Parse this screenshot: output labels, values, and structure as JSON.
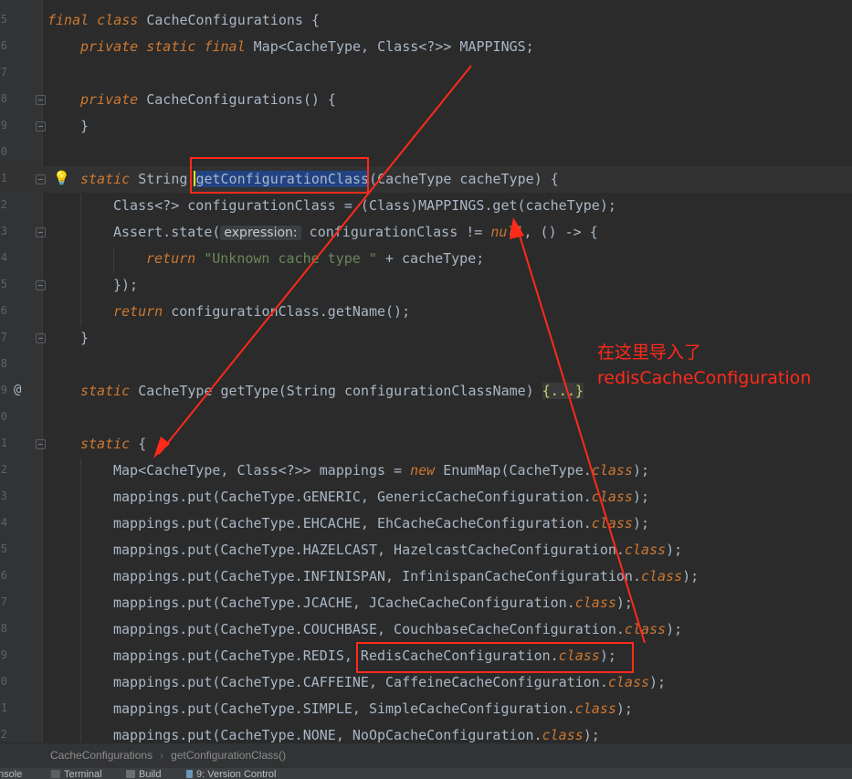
{
  "line_numbers": [
    "5",
    "6",
    "7",
    "8",
    "9",
    "0",
    "1",
    "2",
    "3",
    "4",
    "5",
    "6",
    "7",
    "8",
    "9",
    "0",
    "1",
    "2",
    "3",
    "4",
    "5",
    "6",
    "7",
    "8",
    "9",
    "0",
    "1",
    "2"
  ],
  "code": {
    "class_decl_kw": "final class",
    "class_decl_rest": " CacheConfigurations {",
    "field_kw": "private static final",
    "field_rest": " Map<CacheType, Class<?>> MAPPINGS;",
    "ctor_kw": "private",
    "ctor_rest": " CacheConfigurations() {",
    "ctor_close": "}",
    "method_kw": "static",
    "method_type": " String ",
    "method_name": "getConfigurationClass",
    "method_params": "(CacheType cacheType) {",
    "line_config": "Class<?> configurationClass = (Class)MAPPINGS.get(cacheType);",
    "assert_start": "Assert.state(",
    "assert_hint": "expression:",
    "assert_mid": " configurationClass != ",
    "assert_null": "null",
    "assert_end": ", () -> {",
    "return_kw": "return",
    "return_str": "\"Unknown cache type \"",
    "return_rest": " + cacheType;",
    "lambda_close": "});",
    "return2_kw": "return",
    "return2_rest": " configurationClass.getName();",
    "method_close": "}",
    "gettype_kw": "static",
    "gettype_rest": " CacheType getType(String configurationClassName) ",
    "gettype_fold": "{...}",
    "static_block_kw": "static",
    "static_block_rest": " {",
    "map_decl_a": "Map<CacheType, Class<?>> mappings = ",
    "map_decl_new": "new",
    "map_decl_b": " EnumMap(CacheType.",
    "class_kw": "class",
    "close_paren": ");",
    "put_lines": [
      {
        "pre": "mappings.put(CacheType.GENERIC, GenericCacheConfiguration."
      },
      {
        "pre": "mappings.put(CacheType.EHCACHE, EhCacheCacheConfiguration."
      },
      {
        "pre": "mappings.put(CacheType.HAZELCAST, HazelcastCacheConfiguration."
      },
      {
        "pre": "mappings.put(CacheType.INFINISPAN, InfinispanCacheConfiguration."
      },
      {
        "pre": "mappings.put(CacheType.JCACHE, JCacheCacheConfiguration."
      },
      {
        "pre": "mappings.put(CacheType.COUCHBASE, CouchbaseCacheConfiguration."
      },
      {
        "pre": "mappings.put(CacheType.REDIS, RedisCacheConfiguration."
      },
      {
        "pre": "mappings.put(CacheType.CAFFEINE, CaffeineCacheConfiguration."
      },
      {
        "pre": "mappings.put(CacheType.SIMPLE, SimpleCacheConfiguration."
      },
      {
        "pre": "mappings.put(CacheType.NONE, NoOpCacheConfiguration."
      }
    ]
  },
  "gutter_marker_at": "@",
  "bulb_icon": "💡",
  "annotation": {
    "line1": "在这里导入了",
    "line2": "redisCacheConfiguration",
    "color": "#ff2a1a"
  },
  "breadcrumb": {
    "class_name": "CacheConfigurations",
    "separator": "›",
    "method_name": "getConfigurationClass()"
  },
  "toolwindows": {
    "console": "nsole",
    "terminal": "Terminal",
    "build": "Build",
    "vcs": "9: Version Control"
  },
  "colors": {
    "background": "#2b2b2b",
    "keyword": "#cc7832",
    "string": "#6a8759",
    "text": "#a9b7c6",
    "selection": "#214283",
    "annotation_red": "#ff2a1a"
  }
}
